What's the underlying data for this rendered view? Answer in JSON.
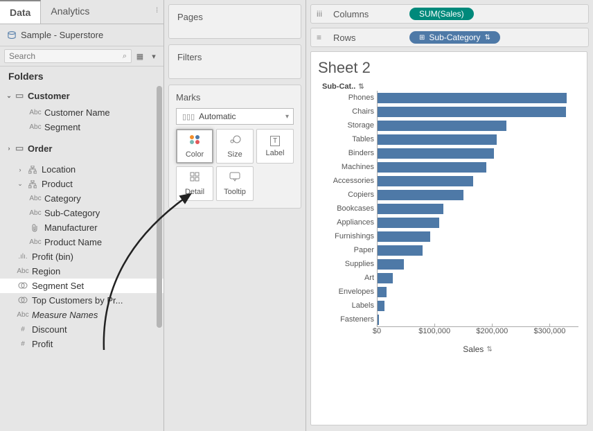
{
  "tabs": {
    "data": "Data",
    "analytics": "Analytics"
  },
  "datasource": "Sample - Superstore",
  "search": {
    "placeholder": "Search"
  },
  "folders_label": "Folders",
  "tree": {
    "customer": {
      "label": "Customer",
      "customer_name": "Customer Name",
      "segment": "Segment"
    },
    "order": {
      "label": "Order"
    },
    "location": {
      "label": "Location"
    },
    "product": {
      "label": "Product",
      "category": "Category",
      "sub_category": "Sub-Category",
      "manufacturer": "Manufacturer",
      "product_name": "Product Name"
    },
    "profit_bin": "Profit (bin)",
    "region": "Region",
    "segment_set": "Segment Set",
    "top_customers": "Top Customers by Pr...",
    "measure_names": "Measure Names",
    "discount": "Discount",
    "profit": "Profit"
  },
  "shelves": {
    "pages": "Pages",
    "filters": "Filters"
  },
  "marks": {
    "title": "Marks",
    "type": "Automatic",
    "color": "Color",
    "size": "Size",
    "label": "Label",
    "detail": "Detail",
    "tooltip": "Tooltip"
  },
  "columns": {
    "label": "Columns",
    "pill": "SUM(Sales)"
  },
  "rows": {
    "label": "Rows",
    "pill": "Sub-Category"
  },
  "viz": {
    "title": "Sheet 2",
    "subcat_header": "Sub-Cat..",
    "xlabel": "Sales"
  },
  "chart_data": {
    "type": "bar",
    "orientation": "horizontal",
    "title": "Sheet 2",
    "xlabel": "Sales",
    "ylabel": "Sub-Category",
    "xlim": [
      0,
      350000
    ],
    "ticks": [
      0,
      100000,
      200000,
      300000
    ],
    "tick_labels": [
      "$0",
      "$100,000",
      "$200,000",
      "$300,000"
    ],
    "categories": [
      "Phones",
      "Chairs",
      "Storage",
      "Tables",
      "Binders",
      "Machines",
      "Accessories",
      "Copiers",
      "Bookcases",
      "Appliances",
      "Furnishings",
      "Paper",
      "Supplies",
      "Art",
      "Envelopes",
      "Labels",
      "Fasteners"
    ],
    "values": [
      330000,
      328000,
      224000,
      207000,
      203000,
      189000,
      167000,
      150000,
      115000,
      108000,
      92000,
      78000,
      46000,
      27000,
      16000,
      12000,
      3000
    ]
  }
}
